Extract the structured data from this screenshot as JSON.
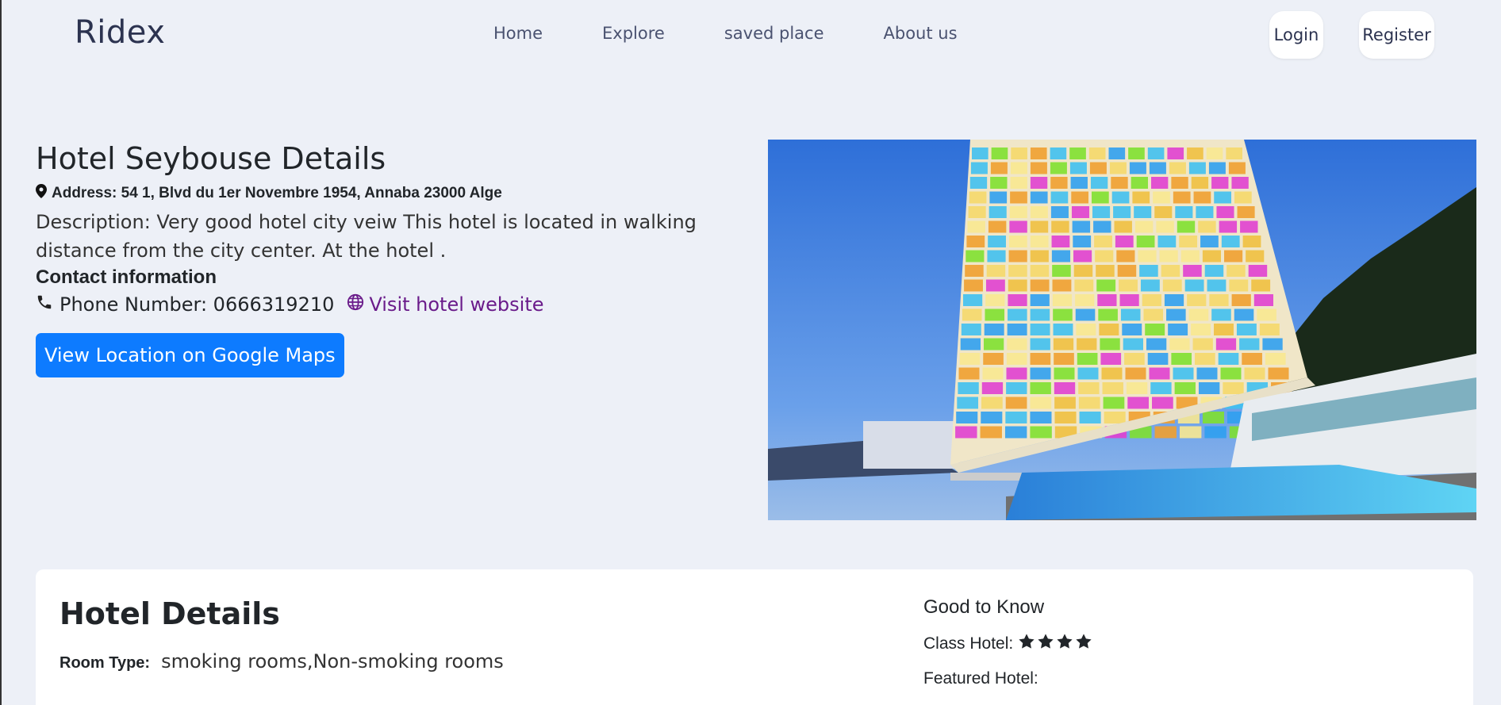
{
  "navbar": {
    "brand": "Ridex",
    "links": [
      "Home",
      "Explore",
      "saved place",
      "About us"
    ],
    "login": "Login",
    "register": "Register"
  },
  "hotel": {
    "title": "Hotel Seybouse Details",
    "address": "Address: 54 1, Blvd du 1er Novembre 1954, Annaba 23000 Alge",
    "description": "Description: Very good hotel city veiw This hotel is located in walking distance from the city center. At the hotel .",
    "contact_title": "Contact information",
    "phone": "Phone Number: 0666319210",
    "website_link": "Visit hotel website",
    "maps_button": "View Location on Google Maps"
  },
  "details": {
    "title": "Hotel Details",
    "room_type_label": "Room Type:",
    "room_type_value": "smoking rooms,Non-smoking rooms",
    "good_to_know_title": "Good to Know",
    "class_label": "Class Hotel:",
    "class_stars": 4,
    "featured_label": "Featured Hotel:"
  },
  "colors": {
    "background": "#edf0f7",
    "primary_button": "#0d7bff",
    "link": "#6a1b8a",
    "brand": "#2c3350"
  },
  "icons": [
    "map-marker-icon",
    "phone-icon",
    "globe-icon",
    "star-icon"
  ]
}
